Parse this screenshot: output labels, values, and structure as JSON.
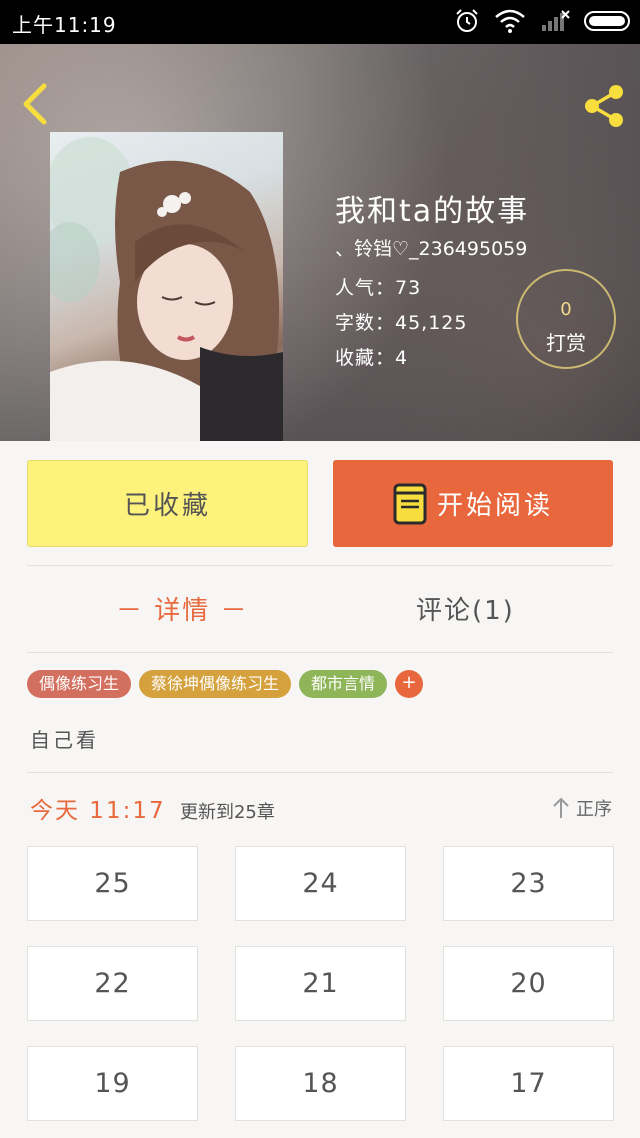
{
  "status_bar": {
    "time": "上午11:19"
  },
  "header": {
    "title": "我和ta的故事",
    "author": "、铃铛♡_236495059",
    "popularity": "人气：73",
    "word_count": "字数：45,125",
    "favorites": "收藏：4",
    "tip_count": "0",
    "tip_label": "打赏"
  },
  "actions": {
    "collected_label": "已收藏",
    "read_label": "开始阅读"
  },
  "tabs": {
    "detail": "－ 详情 －",
    "comments": "评论(1)"
  },
  "tags": [
    {
      "label": "偶像练习生",
      "color": "#d26f5e"
    },
    {
      "label": "蔡徐坤偶像练习生",
      "color": "#d4a13d"
    },
    {
      "label": "都市言情",
      "color": "#8fb559"
    }
  ],
  "tag_add_label": "+",
  "description": "自己看",
  "update": {
    "today_label": "今天 11:17",
    "info": "更新到25章",
    "sort_label": "正序"
  },
  "chapters": [
    "25",
    "24",
    "23",
    "22",
    "21",
    "20",
    "19",
    "18",
    "17"
  ],
  "colors": {
    "accent": "#e8673c",
    "collect_bg": "#fcf27c",
    "icon_yellow": "#f7dd3e"
  }
}
